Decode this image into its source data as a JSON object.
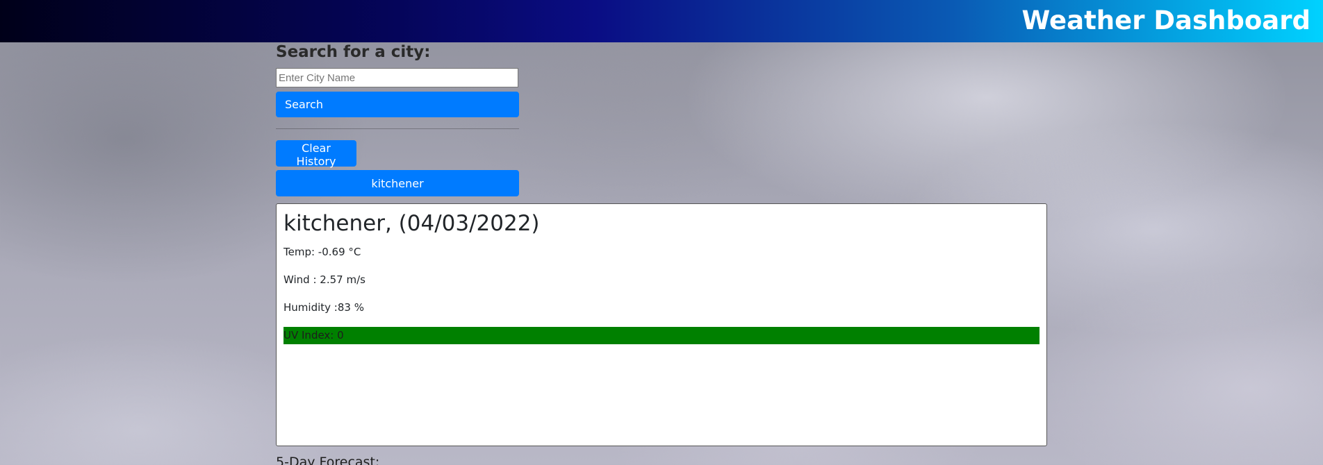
{
  "header": {
    "title": "Weather Dashboard"
  },
  "search": {
    "heading": "Search for a city:",
    "placeholder": "Enter City Name",
    "value": "",
    "button_label": "Search"
  },
  "history": {
    "clear_label": "Clear History",
    "items": [
      {
        "label": "kitchener"
      }
    ]
  },
  "current": {
    "title": "kitchener, (04/03/2022)",
    "temp": "Temp: -0.69 °C",
    "wind": "Wind : 2.57 m/s",
    "humidity": "Humidity :83 %",
    "uv": "UV Index: 0",
    "uv_color": "#008000"
  },
  "forecast": {
    "heading": "5-Day Forecast:"
  },
  "colors": {
    "button": "#007bff",
    "header_gradient": [
      "#000019",
      "#0a0d84",
      "#00d2ff"
    ]
  }
}
